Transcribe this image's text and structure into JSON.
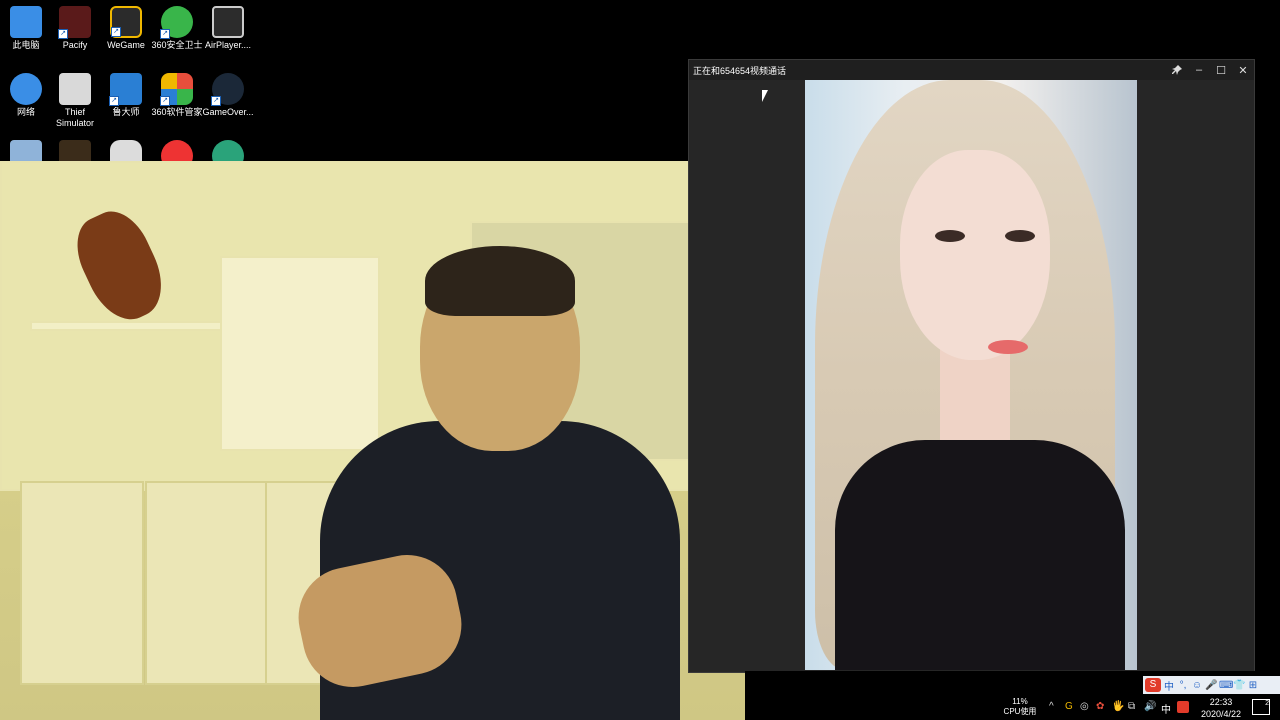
{
  "desktop": {
    "icons": [
      {
        "label": "此电脑",
        "icon": "computer-icon",
        "color": "#3a8ee6"
      },
      {
        "label": "Pacify",
        "icon": "pacify-game-icon",
        "color": "#5a1a1a"
      },
      {
        "label": "WeGame",
        "icon": "wegame-icon",
        "color": "#f0b800"
      },
      {
        "label": "360安全卫士",
        "icon": "360-security-icon",
        "color": "#39b54a"
      },
      {
        "label": "AirPlayer....",
        "icon": "airplayer-icon",
        "color": "#2c2c2c"
      },
      {
        "label": "网络",
        "icon": "network-icon",
        "color": "#3a8ee6"
      },
      {
        "label": "Thief Simulator",
        "icon": "thief-simulator-icon",
        "color": "#d9d9d9"
      },
      {
        "label": "鲁大师",
        "icon": "ludashi-icon",
        "color": "#2a7fd4"
      },
      {
        "label": "360软件管家",
        "icon": "360-software-manager-icon",
        "color": "#e84e3c"
      },
      {
        "label": "GameOver...",
        "icon": "steam-icon",
        "color": "#1b2838"
      },
      {
        "label": "",
        "icon": "recycle-bin-icon",
        "color": "#8fb3d9"
      },
      {
        "label": "",
        "icon": "game-shortcut-icon",
        "color": "#3b2c1a"
      },
      {
        "label": "",
        "icon": "gamepad-icon",
        "color": "#dcdcdc"
      },
      {
        "label": "",
        "icon": "qq-icon",
        "color": "#e33"
      },
      {
        "label": "",
        "icon": "app-icon",
        "color": "#2aa37a"
      }
    ]
  },
  "call_window": {
    "title": "正在和654654视频通话",
    "pin_icon": "pin-icon",
    "minimize": "–",
    "maximize": "☐",
    "close": "✕"
  },
  "taskbar": {
    "cpu_percent": "11%",
    "cpu_label": "CPU使用",
    "ime_items": [
      "S",
      "中",
      "°,",
      "☺",
      "🎤",
      "⌨",
      "👕",
      "⊞"
    ],
    "tray_symbols": [
      "^",
      "G",
      "◎",
      "✿",
      "🖐",
      "⧉",
      "🔊",
      "中"
    ],
    "time": "22:33",
    "date": "2020/4/22",
    "notification_count": "2"
  }
}
